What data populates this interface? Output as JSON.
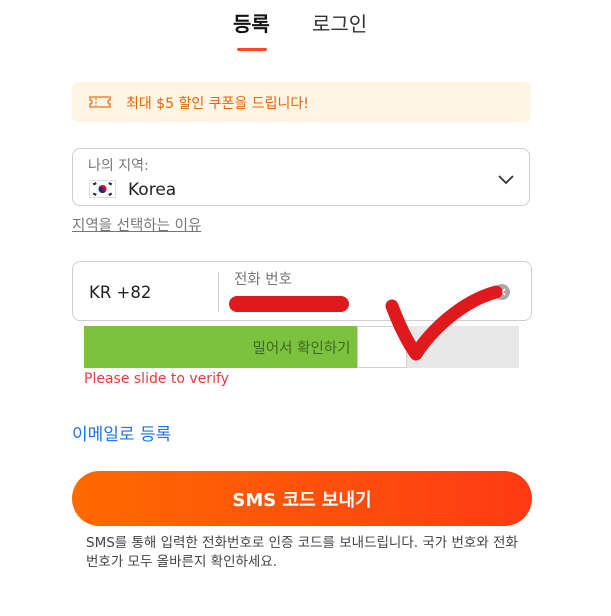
{
  "tabs": {
    "register": "등록",
    "login": "로그인"
  },
  "coupon": {
    "text": "최대 $5 할인 쿠폰을 드립니다!",
    "icon": "ticket-icon"
  },
  "region": {
    "label": "나의 지역:",
    "value": "Korea",
    "flag_icon": "korea-flag-icon"
  },
  "why_link": "지역을 선택하는 이유",
  "phone": {
    "country_code": "KR +82",
    "label": "전화 번호",
    "value": ""
  },
  "slider": {
    "text": "밀어서 확인하기",
    "progress": 0.71,
    "error": "Please slide to verify"
  },
  "email_link": "이메일로 등록",
  "sms_button": "SMS 코드 보내기",
  "sms_note": "SMS를 통해 입력한 전화번호로 인증 코드를 보내드립니다. 국가 번호와 전화번호가 모두 올바른지 확인하세요.",
  "colors": {
    "accent": "#fd4b20",
    "slider_green": "#7cc23f",
    "link_blue": "#1a73e8",
    "error_red": "#e93b3b",
    "coupon_orange": "#e8650a"
  }
}
